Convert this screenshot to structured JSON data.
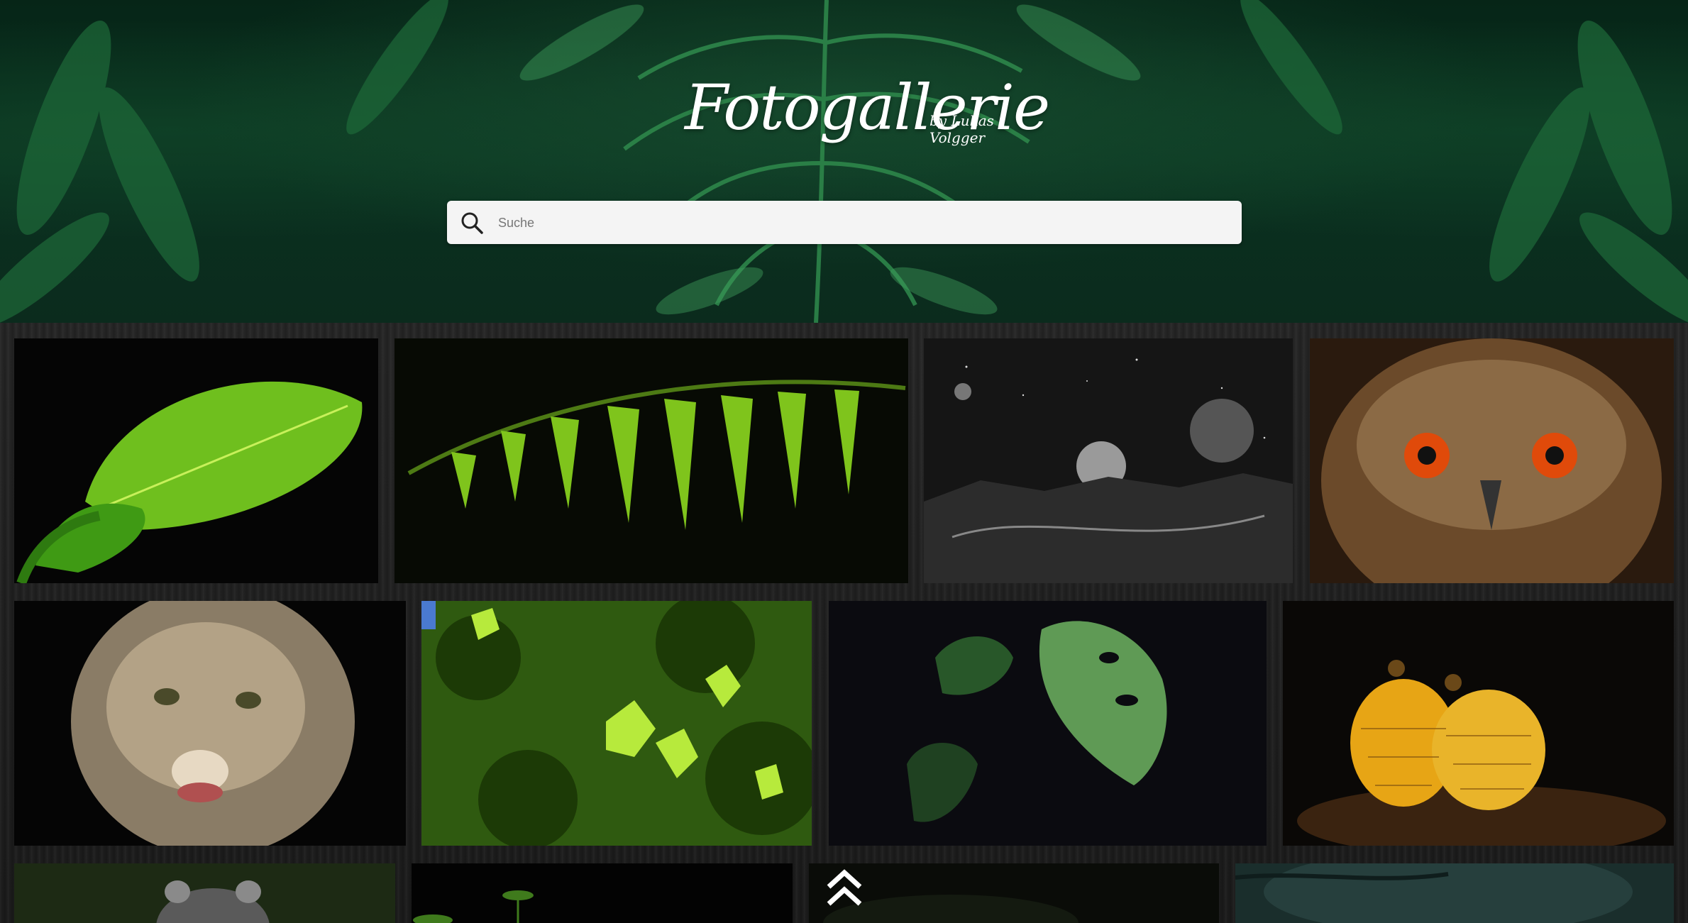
{
  "header": {
    "title": "Fotogallerie",
    "subtitle": "by Lukas Volgger"
  },
  "search": {
    "placeholder": "Suche",
    "icon": "search-icon"
  },
  "gallery": {
    "images": [
      {
        "subject": "green leaf"
      },
      {
        "subject": "fern"
      },
      {
        "subject": "moon landscape"
      },
      {
        "subject": "owl"
      },
      {
        "subject": "cougar"
      },
      {
        "subject": "leaves in sunlight"
      },
      {
        "subject": "monstera leaves"
      },
      {
        "subject": "glowing mushrooms"
      },
      {
        "subject": "raccoon"
      },
      {
        "subject": "plant sprout"
      },
      {
        "subject": "dark forest"
      },
      {
        "subject": "misty forest"
      }
    ]
  },
  "scroll_top": {
    "icon": "double-chevron-up-icon"
  }
}
